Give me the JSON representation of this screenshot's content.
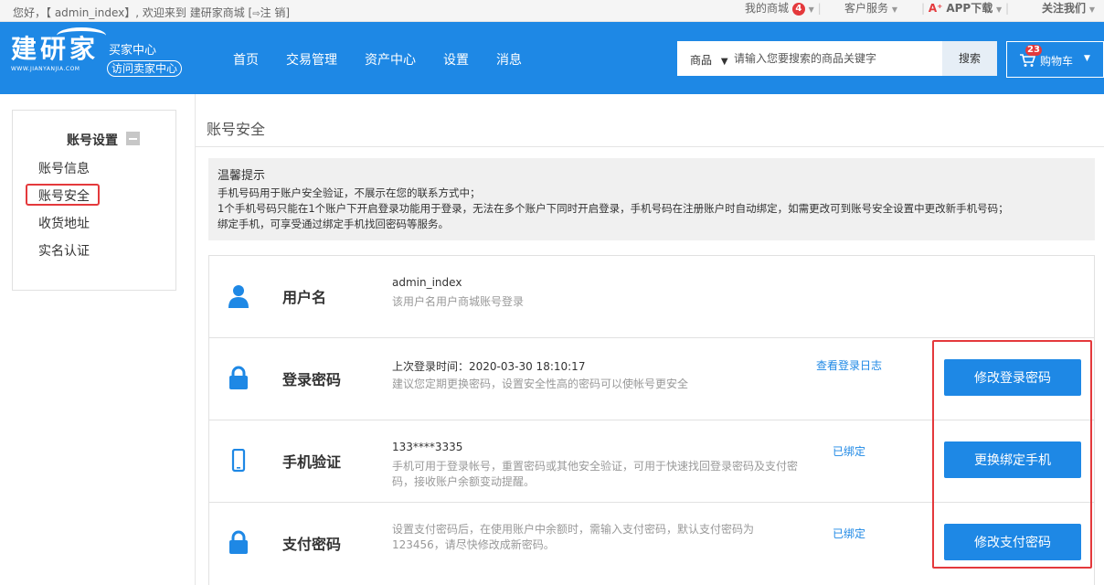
{
  "topbar": {
    "greeting": "您好，【 admin_index】, 欢迎来到 建研家商城 [",
    "logout_icon": "logout-icon",
    "logout": "注 销",
    "logout_end": "]",
    "my_mall": "我的商城",
    "my_mall_count": "4",
    "customer_service": "客户服务",
    "app_download": "APP下载",
    "follow_us": "关注我们"
  },
  "header": {
    "logo_cn": "建研家",
    "logo_en": "WWW.JIANYANJIA.COM",
    "buyer_center": "买家中心",
    "visit_seller": "访问卖家中心",
    "nav": [
      "首页",
      "交易管理",
      "资产中心",
      "设置",
      "消息"
    ],
    "search_category": "商品",
    "search_placeholder": "请输入您要搜索的商品关键字",
    "search_button": "搜索",
    "cart_label": "购物车",
    "cart_count": "23"
  },
  "sidebar": {
    "title": "账号设置",
    "items": [
      "账号信息",
      "账号安全",
      "收货地址",
      "实名认证"
    ],
    "active_index": 1
  },
  "main": {
    "title": "账号安全",
    "notice": {
      "title": "温馨提示",
      "lines": [
        "手机号码用于账户安全验证，不展示在您的联系方式中；",
        "1个手机号码只能在1个账户下开启登录功能用于登录，无法在多个账户下同时开启登录，手机号码在注册账户时自动绑定，如需更改可到账号安全设置中更改新手机号码；",
        "绑定手机，可享受通过绑定手机找回密码等服务。"
      ]
    },
    "rows": [
      {
        "icon": "user-icon",
        "label": "用户名",
        "main": "admin_index",
        "desc": "该用户名用户商城账号登录"
      },
      {
        "icon": "lock-icon",
        "label": "登录密码",
        "main": "上次登录时间：2020-03-30 18:10:17",
        "desc": "建议您定期更换密码，设置安全性高的密码可以使帐号更安全",
        "status": "查看登录日志",
        "button": "修改登录密码"
      },
      {
        "icon": "phone-icon",
        "label": "手机验证",
        "main": "133****3335",
        "desc": "手机可用于登录帐号，重置密码或其他安全验证，可用于快速找回登录密码及支付密码，接收账户余额变动提醒。",
        "status": "已绑定",
        "button": "更换绑定手机"
      },
      {
        "icon": "lock-icon",
        "label": "支付密码",
        "desc": "设置支付密码后，在使用账户中余额时，需输入支付密码，默认支付密码为123456，请尽快修改成新密码。",
        "status": "已绑定",
        "button": "修改支付密码"
      }
    ]
  },
  "colors": {
    "brand_blue": "#1e88e5",
    "highlight_red": "#e4393c"
  }
}
